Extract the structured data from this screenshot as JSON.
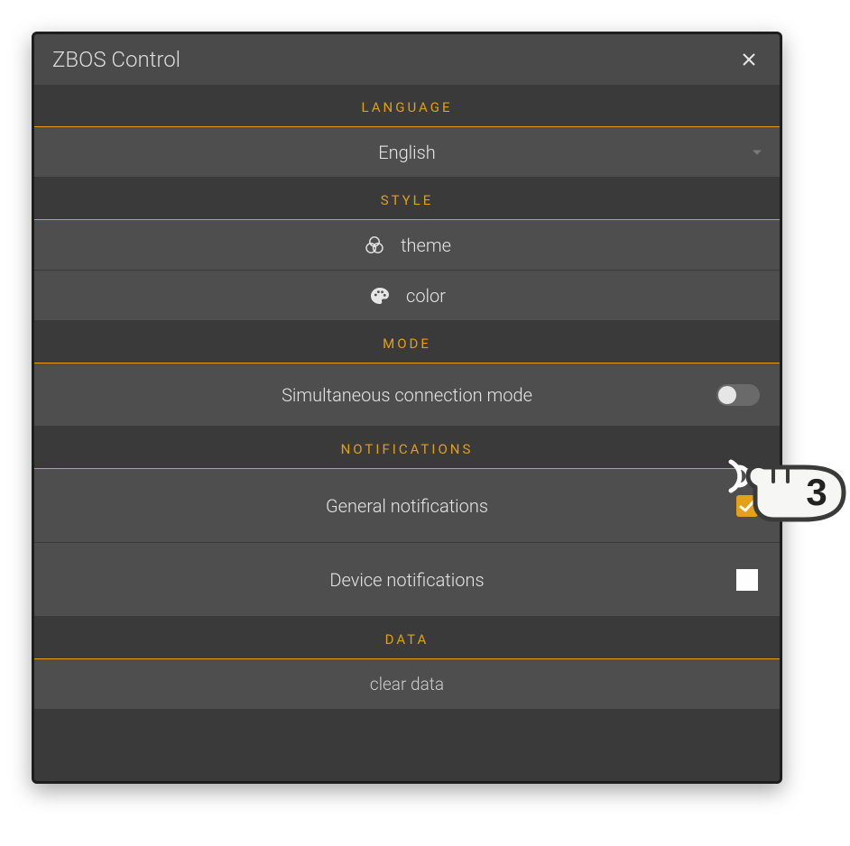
{
  "dialog": {
    "title": "ZBOS Control"
  },
  "sections": {
    "language": {
      "header": "LANGUAGE",
      "selected": "English"
    },
    "style": {
      "header": "STYLE",
      "theme_label": "theme",
      "color_label": "color"
    },
    "mode": {
      "header": "MODE",
      "simultaneous_label": "Simultaneous connection mode",
      "simultaneous_enabled": false
    },
    "notifications": {
      "header": "NOTIFICATIONS",
      "general_label": "General notifications",
      "general_checked": true,
      "device_label": "Device notifications",
      "device_checked": false
    },
    "data": {
      "header": "DATA",
      "clear_label": "clear data"
    }
  },
  "callout": {
    "step_number": "3"
  },
  "colors": {
    "accent": "#e0a018",
    "panel_dark": "#3a3a3a",
    "panel_row": "#4e4e4e",
    "titlebar": "#4a4a4a"
  }
}
